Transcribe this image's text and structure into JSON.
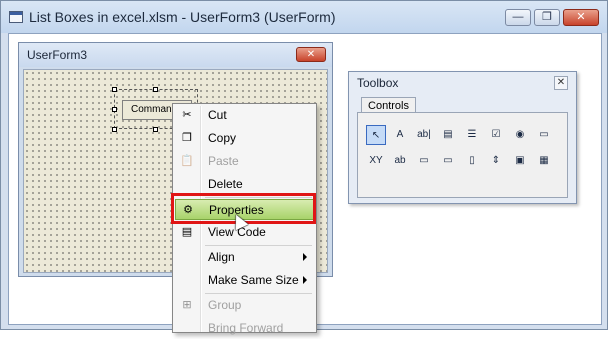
{
  "window": {
    "title": "List Boxes in excel.xlsm - UserForm3 (UserForm)",
    "controls": {
      "minimize": "—",
      "maximize": "❐",
      "close": "✕"
    }
  },
  "userform": {
    "title": "UserForm3",
    "close": "✕",
    "button_label": "CommandB"
  },
  "toolbox": {
    "title": "Toolbox",
    "close": "✕",
    "tab": "Controls",
    "tools": [
      {
        "name": "select-objects-icon",
        "glyph": "↖"
      },
      {
        "name": "label-icon",
        "glyph": "A"
      },
      {
        "name": "textbox-icon",
        "glyph": "ab|"
      },
      {
        "name": "combobox-icon",
        "glyph": "▤"
      },
      {
        "name": "listbox-icon",
        "glyph": "☰"
      },
      {
        "name": "checkbox-icon",
        "glyph": "☑"
      },
      {
        "name": "optionbutton-icon",
        "glyph": "◉"
      },
      {
        "name": "togglebutton-icon",
        "glyph": "▭"
      },
      {
        "name": "frame-icon",
        "glyph": "XY"
      },
      {
        "name": "commandbutton-icon",
        "glyph": "ab"
      },
      {
        "name": "tabstrip-icon",
        "glyph": "▭"
      },
      {
        "name": "multipage-icon",
        "glyph": "▭"
      },
      {
        "name": "scrollbar-icon",
        "glyph": "▯"
      },
      {
        "name": "spinbutton-icon",
        "glyph": "⇕"
      },
      {
        "name": "image-icon",
        "glyph": "▣"
      },
      {
        "name": "refedit-icon",
        "glyph": "▦"
      }
    ]
  },
  "context_menu": {
    "items": [
      {
        "label": "Cut",
        "icon": "✂"
      },
      {
        "label": "Copy",
        "icon": "❐"
      },
      {
        "label": "Paste",
        "icon": "📋"
      },
      {
        "label": "Delete",
        "icon": ""
      },
      {
        "label": "Properties",
        "icon": "⚙"
      },
      {
        "label": "View Code",
        "icon": "▤"
      },
      {
        "label": "Align",
        "icon": ""
      },
      {
        "label": "Make Same Size",
        "icon": ""
      },
      {
        "label": "Group",
        "icon": "⊞"
      },
      {
        "label": "Bring Forward",
        "icon": ""
      }
    ]
  }
}
